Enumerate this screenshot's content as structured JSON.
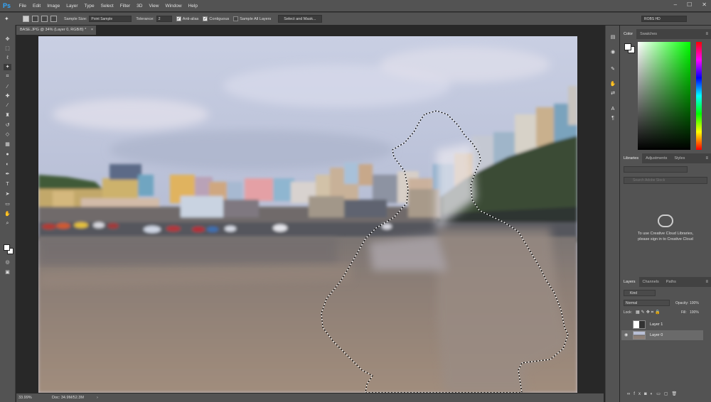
{
  "menubar": {
    "logo": "Ps",
    "items": [
      "File",
      "Edit",
      "Image",
      "Layer",
      "Type",
      "Select",
      "Filter",
      "3D",
      "View",
      "Window",
      "Help"
    ],
    "window_controls": [
      "–",
      "☐",
      "✕"
    ]
  },
  "options": {
    "sample_size_label": "Sample Size:",
    "sample_size_value": "Point Sample",
    "tolerance_label": "Tolerance:",
    "tolerance_value": "2",
    "anti_alias_label": "Anti-alias",
    "contiguous_label": "Contiguous",
    "sample_all_layers_label": "Sample All Layers",
    "select_mask_button": "Select and Mask...",
    "workspace": "ROBS HD"
  },
  "document": {
    "tab_title": "BASE.JPG @ 34% (Layer 0, RGB/8) *",
    "tab_close": "×",
    "zoom": "33.99%",
    "doc_size": "Doc: 34.9M/52.3M"
  },
  "panels": {
    "color_tabs": [
      "Color",
      "Swatches"
    ],
    "libraries_tabs": [
      "Libraries",
      "Adjustments",
      "Styles"
    ],
    "libraries_search_placeholder": "Search Adobe Stock",
    "libraries_message_1": "To use Creative Cloud Libraries,",
    "libraries_message_2": "please sign in to Creative Cloud",
    "layers_tabs": [
      "Layers",
      "Channels",
      "Paths"
    ],
    "layers_kind": "Kind",
    "blend_mode": "Normal",
    "opacity_label": "Opacity:",
    "opacity_value": "100%",
    "lock_label": "Lock:",
    "fill_label": "Fill:",
    "fill_value": "100%",
    "layers": [
      {
        "name": "Layer 1"
      },
      {
        "name": "Layer 0"
      }
    ]
  },
  "colors": {
    "chrome": "#535353",
    "dark": "#282828",
    "selection": "#ffffff"
  }
}
